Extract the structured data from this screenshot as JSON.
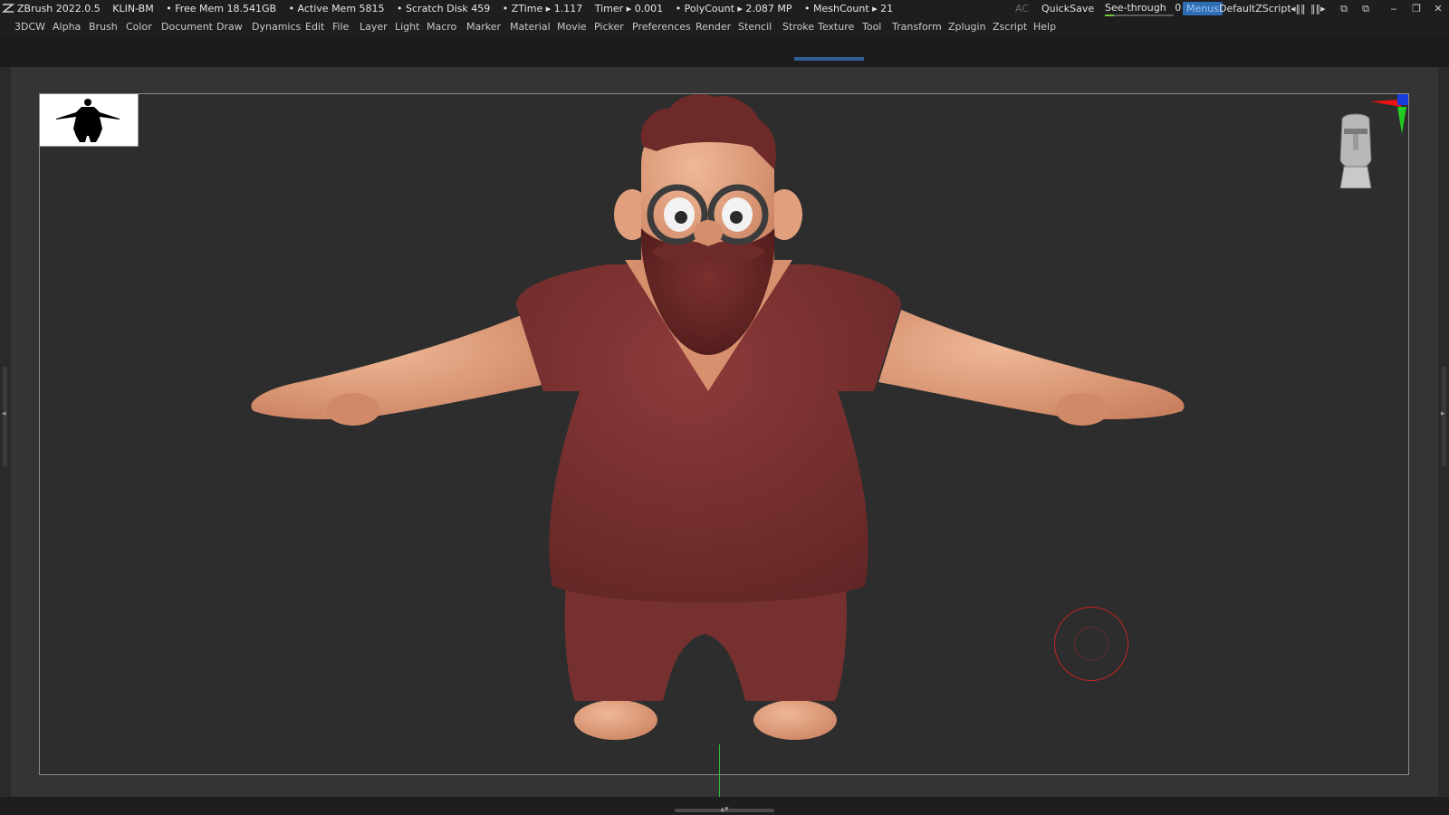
{
  "titlebar": {
    "app": "ZBrush 2022.0.5",
    "document": "KLIN-BM",
    "free_mem": "• Free Mem 18.541GB",
    "active_mem": "• Active Mem 5815",
    "scratch_disk": "• Scratch Disk 459",
    "ztime": "• ZTime ▸ 1.117",
    "timer": "Timer ▸ 0.001",
    "polycount": "• PolyCount ▸ 2.087 MP",
    "meshcount": "• MeshCount ▸ 21",
    "ac": "AC",
    "quicksave": "QuickSave",
    "see_through_label": "See-through",
    "see_through_value": "0",
    "menus": "Menus",
    "script": "DefaultZScript"
  },
  "menu": [
    "3DCW",
    "Alpha",
    "Brush",
    "Color",
    "Document",
    "Draw",
    "Dynamics",
    "Edit",
    "File",
    "Layer",
    "Light",
    "Macro",
    "Marker",
    "Material",
    "Movie",
    "Picker",
    "Preferences",
    "Render",
    "Stencil",
    "Stroke",
    "Texture",
    "Tool",
    "Transform",
    "Zplugin",
    "Zscript",
    "Help"
  ],
  "colors": {
    "accent": "#2f6db5",
    "skin": "#e2a07e",
    "shirt": "#7c3232",
    "hair": "#6e2a28",
    "brush_cursor": "#c42424",
    "floor_line": "#2fbf3a"
  },
  "icons": {
    "logo": "zbrush-logo-icon",
    "axis": "axis-gizmo-icon",
    "head": "navigation-head-icon"
  }
}
